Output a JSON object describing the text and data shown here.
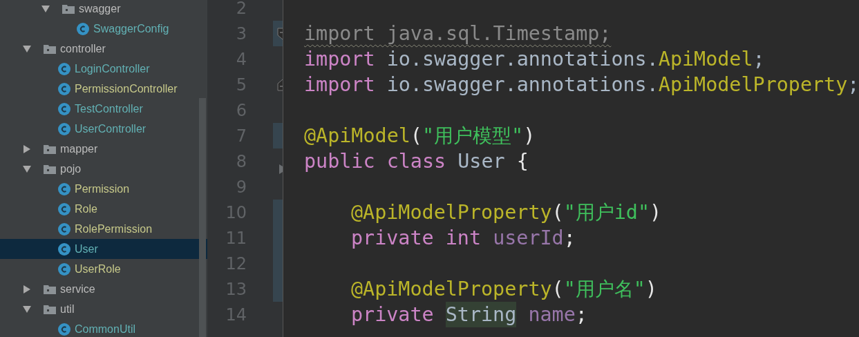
{
  "project_tree": [
    {
      "kind": "continued",
      "children": [
        {
          "kind": "folder",
          "label": "swagger",
          "expanded": true,
          "selected": false,
          "color": "#bbbbbb",
          "children": [
            {
              "kind": "class",
              "label": "SwaggerConfig",
              "selected": false,
              "color": "#62b1b4"
            }
          ]
        }
      ]
    },
    {
      "kind": "folder",
      "label": "controller",
      "expanded": true,
      "selected": false,
      "color": "#bbbbbb",
      "children": [
        {
          "kind": "class",
          "label": "LoginController",
          "selected": false,
          "color": "#62b1b4"
        },
        {
          "kind": "class",
          "label": "PermissionController",
          "selected": false,
          "color": "#c7c98a"
        },
        {
          "kind": "class",
          "label": "TestController",
          "selected": false,
          "color": "#62b1b4"
        },
        {
          "kind": "class",
          "label": "UserController",
          "selected": false,
          "color": "#62b1b4"
        }
      ]
    },
    {
      "kind": "folder",
      "label": "mapper",
      "expanded": false,
      "selected": false,
      "color": "#bbbbbb"
    },
    {
      "kind": "folder",
      "label": "pojo",
      "expanded": true,
      "selected": false,
      "color": "#bbbbbb",
      "children": [
        {
          "kind": "class",
          "label": "Permission",
          "selected": false,
          "color": "#c7c98a"
        },
        {
          "kind": "class",
          "label": "Role",
          "selected": false,
          "color": "#c7c98a"
        },
        {
          "kind": "class",
          "label": "RolePermission",
          "selected": false,
          "color": "#c7c98a"
        },
        {
          "kind": "class",
          "label": "User",
          "selected": true,
          "color": "#62b1b4"
        },
        {
          "kind": "class",
          "label": "UserRole",
          "selected": false,
          "color": "#c7c98a"
        }
      ]
    },
    {
      "kind": "folder",
      "label": "service",
      "expanded": false,
      "selected": false,
      "color": "#bbbbbb"
    },
    {
      "kind": "folder",
      "label": "util",
      "expanded": true,
      "selected": false,
      "color": "#bbbbbb",
      "children": [
        {
          "kind": "class",
          "label": "CommonUtil",
          "selected": false,
          "color": "#62b1b4"
        }
      ]
    }
  ],
  "editor": {
    "lines": [
      {
        "number": "2",
        "changed": false
      },
      {
        "number": "3",
        "changed": true,
        "fold_start": true,
        "tokens": [
          {
            "kind": "unused",
            "text": "import java.sql.Timestamp;"
          }
        ]
      },
      {
        "number": "4",
        "changed": false,
        "tokens": [
          {
            "kind": "keyword",
            "text": "import"
          },
          {
            "kind": "plain",
            "text": " io.swagger.annotations."
          },
          {
            "kind": "annotation",
            "text": "ApiModel"
          },
          {
            "kind": "plain",
            "text": ";"
          }
        ]
      },
      {
        "number": "5",
        "changed": false,
        "fold_end": true,
        "tokens": [
          {
            "kind": "keyword",
            "text": "import"
          },
          {
            "kind": "plain",
            "text": " io.swagger.annotations."
          },
          {
            "kind": "annotation",
            "text": "ApiModelProperty"
          },
          {
            "kind": "plain",
            "text": ";"
          }
        ]
      },
      {
        "number": "6",
        "changed": false
      },
      {
        "number": "7",
        "changed": true,
        "tokens": [
          {
            "kind": "annotation",
            "text": "@ApiModel"
          },
          {
            "kind": "paren",
            "text": "("
          },
          {
            "kind": "string",
            "text": "\"用户模型\""
          },
          {
            "kind": "paren",
            "text": ")"
          }
        ]
      },
      {
        "number": "8",
        "changed": false,
        "arrow": true,
        "tokens": [
          {
            "kind": "keyword",
            "text": "public class"
          },
          {
            "kind": "plain",
            "text": " User "
          },
          {
            "kind": "paren",
            "text": "{"
          }
        ]
      },
      {
        "number": "9",
        "changed": false
      },
      {
        "number": "10",
        "changed": true,
        "indented": true,
        "tokens": [
          {
            "kind": "annotation",
            "text": "@ApiModelProperty"
          },
          {
            "kind": "paren",
            "text": "("
          },
          {
            "kind": "string",
            "text": "\"用户id\""
          },
          {
            "kind": "paren",
            "text": ")"
          }
        ]
      },
      {
        "number": "11",
        "changed": true,
        "indented": true,
        "tokens": [
          {
            "kind": "keyword",
            "text": "private int"
          },
          {
            "kind": "space"
          },
          {
            "kind": "field",
            "text": "userId"
          },
          {
            "kind": "paren",
            "text": ";"
          }
        ]
      },
      {
        "number": "12",
        "changed": true
      },
      {
        "number": "13",
        "changed": true,
        "indented": true,
        "tokens": [
          {
            "kind": "annotation",
            "text": "@ApiModelProperty"
          },
          {
            "kind": "paren",
            "text": "("
          },
          {
            "kind": "string",
            "text": "\"用户名\""
          },
          {
            "kind": "paren",
            "text": ")"
          }
        ]
      },
      {
        "number": "14",
        "changed": false,
        "indented": true,
        "tokens": [
          {
            "kind": "keyword",
            "text": "private"
          },
          {
            "kind": "space"
          },
          {
            "kind": "highlight",
            "text": "String"
          },
          {
            "kind": "space"
          },
          {
            "kind": "field",
            "text": "name"
          },
          {
            "kind": "paren",
            "text": ";"
          }
        ]
      }
    ]
  }
}
